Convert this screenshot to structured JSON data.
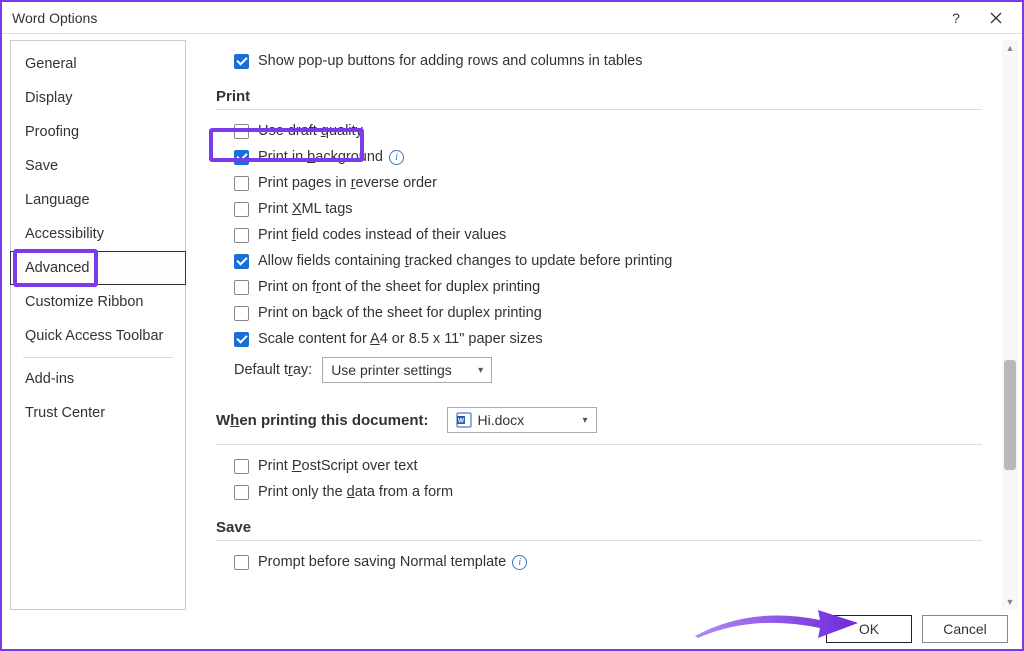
{
  "titlebar": {
    "title": "Word Options"
  },
  "sidebar": {
    "items": [
      "General",
      "Display",
      "Proofing",
      "Save",
      "Language",
      "Accessibility",
      "Advanced",
      "Customize Ribbon",
      "Quick Access Toolbar"
    ],
    "items2": [
      "Add-ins",
      "Trust Center"
    ],
    "selected_index": 6
  },
  "content": {
    "row_popup": "Show pop-up buttons for adding rows and columns in tables",
    "section_print": "Print",
    "opt_draft": "Use draft ",
    "opt_draft_u": "q",
    "opt_draft_rest": "uality",
    "opt_bg_pre": "Print in ",
    "opt_bg_u": "b",
    "opt_bg_rest": "ackground",
    "opt_rev_pre": "Print pages in ",
    "opt_rev_u": "r",
    "opt_rev_rest": "everse order",
    "opt_xml_pre": "Print ",
    "opt_xml_u": "X",
    "opt_xml_rest": "ML tags",
    "opt_fcodes_pre": "Print ",
    "opt_fcodes_u": "f",
    "opt_fcodes_rest": "ield codes instead of their values",
    "opt_tracked_pre": "Allow fields containing ",
    "opt_tracked_u": "t",
    "opt_tracked_rest": "racked changes to update before printing",
    "opt_front_pre": "Print on f",
    "opt_front_u": "r",
    "opt_front_rest": "ont of the sheet for duplex printing",
    "opt_back_pre": "Print on b",
    "opt_back_u": "a",
    "opt_back_rest": "ck of the sheet for duplex printing",
    "opt_scale_pre": "Scale content for ",
    "opt_scale_u": "A",
    "opt_scale_rest": "4 or 8.5 x 11\" paper sizes",
    "tray_label_pre": "Default t",
    "tray_label_u": "r",
    "tray_label_rest": "ay:",
    "tray_value": "Use printer settings",
    "section_docprint_pre": "W",
    "section_docprint_u": "h",
    "section_docprint_rest": "en printing this document:",
    "doc_name": "Hi.docx",
    "opt_ps_pre": "Print ",
    "opt_ps_u": "P",
    "opt_ps_rest": "ostScript over text",
    "opt_formdata_pre": "Print only the ",
    "opt_formdata_u": "d",
    "opt_formdata_rest": "ata from a form",
    "section_save": "Save",
    "opt_normal": "Prompt before saving Normal template"
  },
  "footer": {
    "ok": "OK",
    "cancel": "Cancel"
  }
}
